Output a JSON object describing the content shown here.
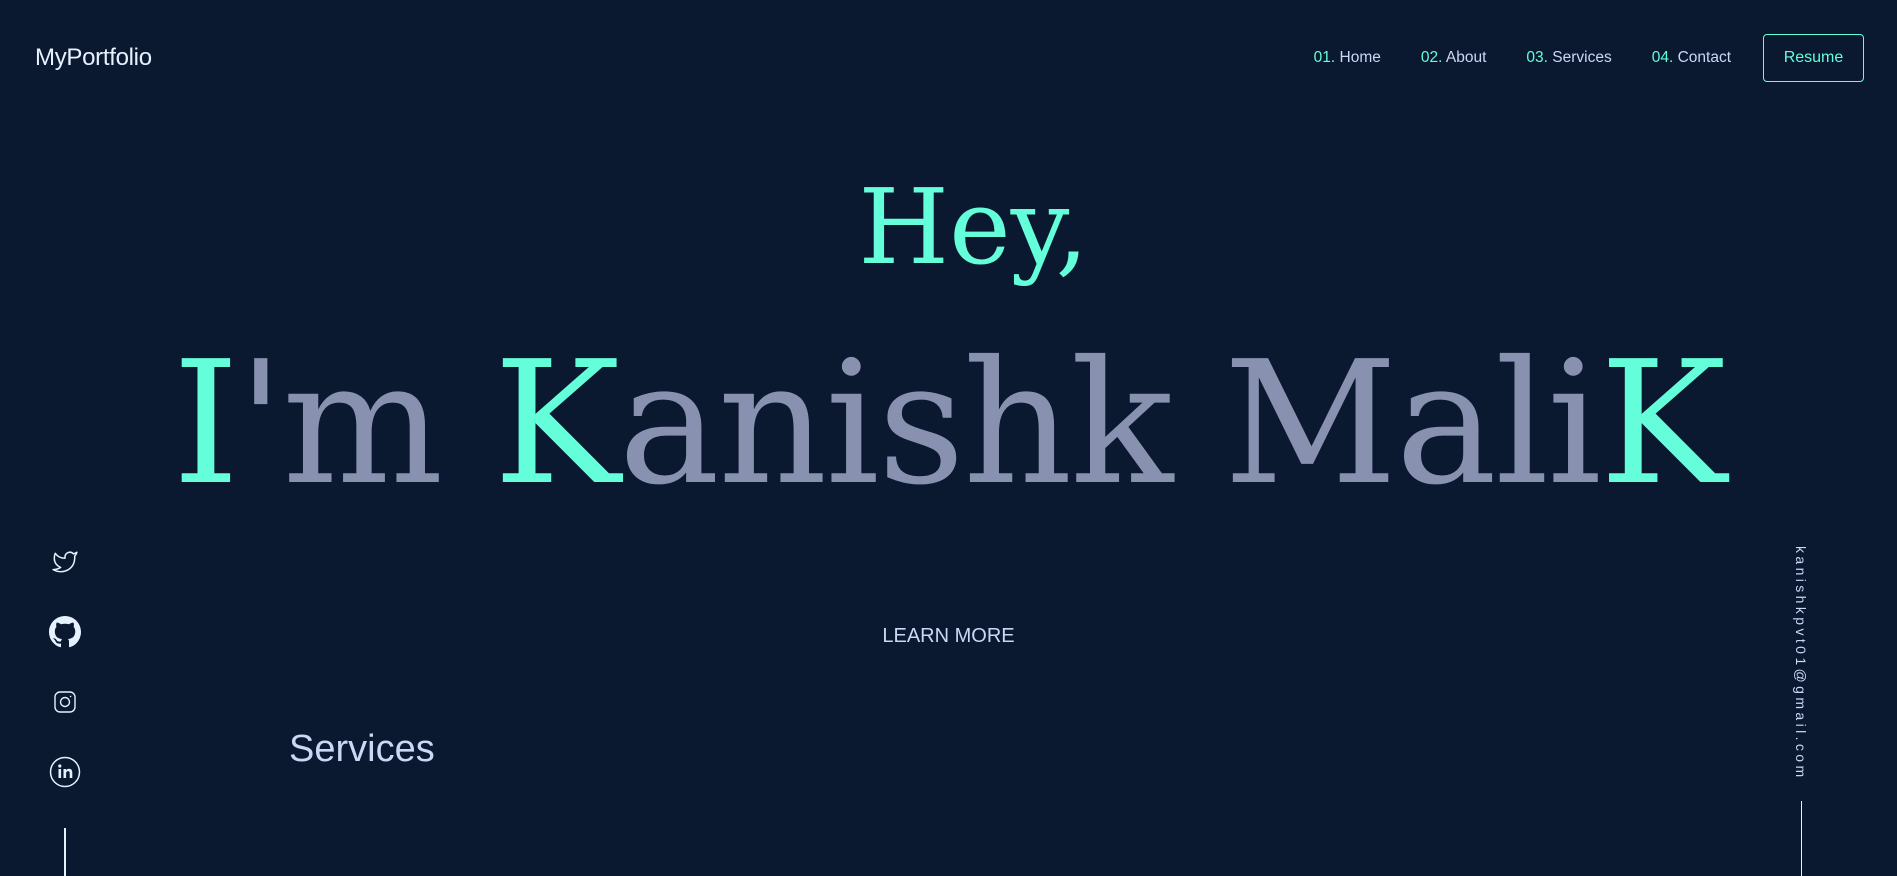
{
  "header": {
    "logo": "MyPortfolio",
    "nav": [
      {
        "num": "01.",
        "label": "Home"
      },
      {
        "num": "02.",
        "label": "About"
      },
      {
        "num": "03.",
        "label": "Services"
      },
      {
        "num": "04.",
        "label": "Contact"
      }
    ],
    "resume_label": "Resume"
  },
  "hero": {
    "greeting": "Hey,",
    "name_parts": [
      "I",
      "'m ",
      "K",
      "anishk Mali",
      "K"
    ],
    "learn_more": "LEARN MORE"
  },
  "services": {
    "heading": "Services"
  },
  "social": {
    "icons": [
      "twitter-icon",
      "github-icon",
      "instagram-icon",
      "linkedin-icon"
    ]
  },
  "email": "kanishkpvt01@gmail.com",
  "colors": {
    "background": "#0a192f",
    "accent": "#64ffda",
    "text": "#ccd6f6",
    "muted": "#8892b0"
  }
}
